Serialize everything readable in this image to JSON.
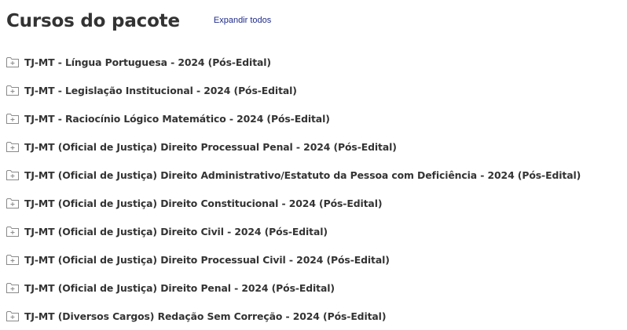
{
  "header": {
    "title": "Cursos do pacote",
    "expand_all_label": "Expandir todos"
  },
  "courses": [
    {
      "label": "TJ-MT - Língua Portuguesa - 2024 (Pós-Edital)",
      "icon": "folder-plus-icon"
    },
    {
      "label": "TJ-MT - Legislação Institucional - 2024 (Pós-Edital)",
      "icon": "folder-plus-icon"
    },
    {
      "label": "TJ-MT - Raciocínio Lógico Matemático - 2024 (Pós-Edital)",
      "icon": "folder-plus-icon"
    },
    {
      "label": "TJ-MT (Oficial de Justiça) Direito Processual Penal - 2024 (Pós-Edital)",
      "icon": "folder-plus-icon"
    },
    {
      "label": "TJ-MT (Oficial de Justiça) Direito Administrativo/Estatuto da Pessoa com Deficiência - 2024 (Pós-Edital)",
      "icon": "folder-plus-icon"
    },
    {
      "label": "TJ-MT (Oficial de Justiça) Direito Constitucional - 2024 (Pós-Edital)",
      "icon": "folder-plus-icon"
    },
    {
      "label": "TJ-MT (Oficial de Justiça) Direito Civil - 2024 (Pós-Edital)",
      "icon": "folder-plus-icon"
    },
    {
      "label": "TJ-MT (Oficial de Justiça) Direito Processual Civil - 2024 (Pós-Edital)",
      "icon": "folder-plus-icon"
    },
    {
      "label": "TJ-MT (Oficial de Justiça) Direito Penal - 2024 (Pós-Edital)",
      "icon": "folder-plus-icon"
    },
    {
      "label": "TJ-MT (Diversos Cargos) Redação Sem Correção - 2024 (Pós-Edital)",
      "icon": "folder-plus-icon"
    }
  ],
  "colors": {
    "text": "#333333",
    "link": "#1f2b8a",
    "icon_stroke": "#8a8a8a"
  }
}
